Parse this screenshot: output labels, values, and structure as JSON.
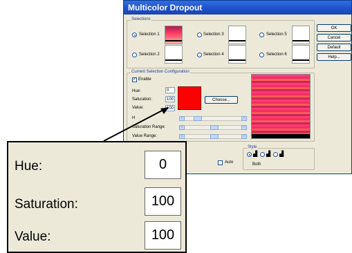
{
  "dialog": {
    "title": "Multicolor Dropout",
    "selections_group": "Selections",
    "selections": [
      {
        "label": "Selection 1",
        "selected": true
      },
      {
        "label": "Selection 2",
        "selected": false
      },
      {
        "label": "Selection 3",
        "selected": false
      },
      {
        "label": "Selection 4",
        "selected": false
      },
      {
        "label": "Selection 5",
        "selected": false
      },
      {
        "label": "Selection 6",
        "selected": false
      }
    ],
    "buttons": {
      "ok": "OK",
      "cancel": "Cancel",
      "default": "Default",
      "help": "Help..."
    },
    "config_group": "Current Selection Configuration",
    "enable_label": "Enable",
    "hue_label": "Hue:",
    "hue_value": "0",
    "saturation_label": "Saturation:",
    "saturation_value": "100",
    "value_label": "Value:",
    "value_value": "100",
    "choose_button": "Choose...",
    "hue_range_label": "H",
    "saturation_range_label": "Saturation Range:",
    "value_range_label": "Value Range:",
    "auto_label": "Auto",
    "style_group": "Style",
    "both_label": "Both",
    "preview_color": "#ff0000"
  },
  "zoom": {
    "hue_label": "Hue:",
    "hue_value": "0",
    "saturation_label": "Saturation:",
    "saturation_value": "100",
    "value_label": "Value:",
    "value_value": "100"
  }
}
